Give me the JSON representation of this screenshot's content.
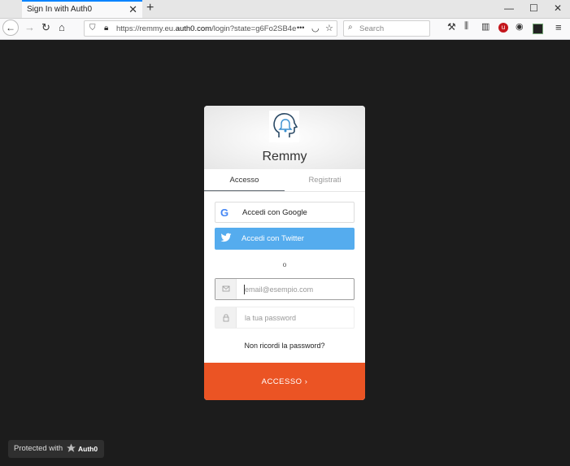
{
  "browser": {
    "tab_title": "Sign In with Auth0",
    "tab_close": "✕",
    "new_tab": "+",
    "window_controls": {
      "minimize": "—",
      "maximize": "☐",
      "close": "✕"
    },
    "url_prefix": "https://remmy.eu.",
    "url_domain": "auth0.com",
    "url_suffix": "/login?state=g6Fo2SB4e",
    "search_placeholder": "Search",
    "page_actions": "•••"
  },
  "login": {
    "app_name": "Remmy",
    "tabs": {
      "login": "Accesso",
      "signup": "Registrati"
    },
    "google_label": "Accedi con Google",
    "google_glyph": "G",
    "twitter_label": "Accedi con Twitter",
    "or": "o",
    "email_placeholder": "email@esempio.com",
    "password_placeholder": "la tua password",
    "forgot": "Non ricordi la password?",
    "submit": "ACCESSO ›"
  },
  "badge": {
    "label": "Protected with",
    "brand": "Auth0"
  },
  "colors": {
    "submit": "#eb5424",
    "twitter": "#55acee",
    "tab_accent": "#0a84ff",
    "background": "#1c1c1c"
  }
}
